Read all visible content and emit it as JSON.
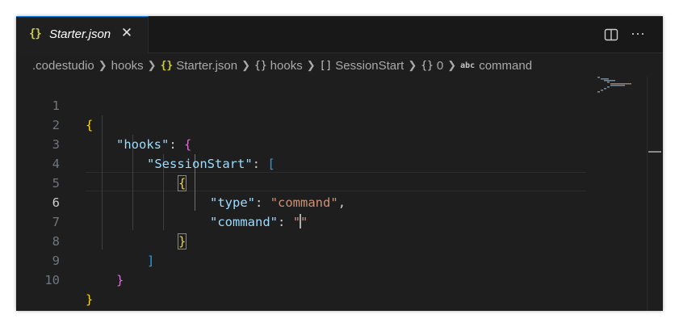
{
  "tab": {
    "icon": "{}",
    "label": "Starter.json",
    "close": "✕"
  },
  "actions": {
    "split_editor_icon": "split-editor-icon",
    "more_icon": "···"
  },
  "breadcrumb": {
    "root": ".codestudio",
    "folder": "hooks",
    "file_icon": "{}",
    "file": "Starter.json",
    "obj_icon": "{}",
    "obj_key": "hooks",
    "arr_icon": "[]",
    "arr_key": "SessionStart",
    "item_icon": "{}",
    "item_key": "0",
    "str_icon": "abc",
    "str_key": "command"
  },
  "lines": [
    {
      "n": "1"
    },
    {
      "n": "2"
    },
    {
      "n": "3"
    },
    {
      "n": "4"
    },
    {
      "n": "5"
    },
    {
      "n": "6"
    },
    {
      "n": "7"
    },
    {
      "n": "8"
    },
    {
      "n": "9"
    },
    {
      "n": "10"
    }
  ],
  "code": {
    "brace_open": "{",
    "hooks_key": "\"hooks\"",
    "colon": ":",
    "comma": ",",
    "session_key": "\"SessionStart\"",
    "bracket_open": "[",
    "type_key": "\"type\"",
    "type_val": "\"command\"",
    "command_key": "\"command\"",
    "quote_open": "\"",
    "quote_close": "\"",
    "brace_close": "}",
    "bracket_close": "]"
  },
  "colors": {
    "background": "#1e1e1e",
    "key": "#9cdcfe",
    "string": "#ce9178",
    "bracket_level1": "#ffd700",
    "bracket_level2": "#da70d6",
    "bracket_level3": "#179fff",
    "accent": "#0078d4"
  },
  "cursor": {
    "line": "6"
  }
}
